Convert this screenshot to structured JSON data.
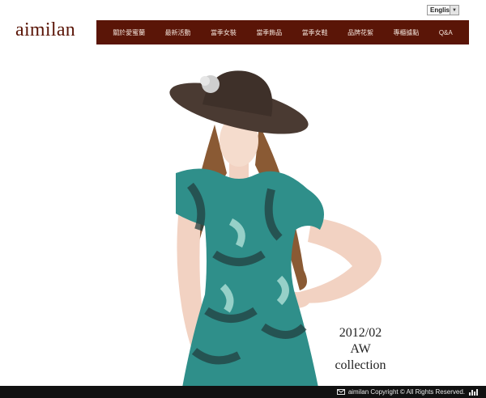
{
  "header": {
    "language": "English",
    "logo": "aimilan"
  },
  "nav": {
    "items": [
      "關於愛蜜蘭",
      "最新活動",
      "當季女裝",
      "當季飾品",
      "當季女鞋",
      "品牌花絮",
      "專櫃據點",
      "Q&A"
    ]
  },
  "hero": {
    "line1": "2012/02",
    "line2": "AW",
    "line3": "collection"
  },
  "footer": {
    "copyright": "aimilan Copyright © All Rights Reserved."
  },
  "colors": {
    "brand": "#5a1507",
    "footer_bg": "#111111"
  },
  "icons": {
    "footer_left": "mail-icon",
    "footer_right": "bar-chart-icon"
  }
}
